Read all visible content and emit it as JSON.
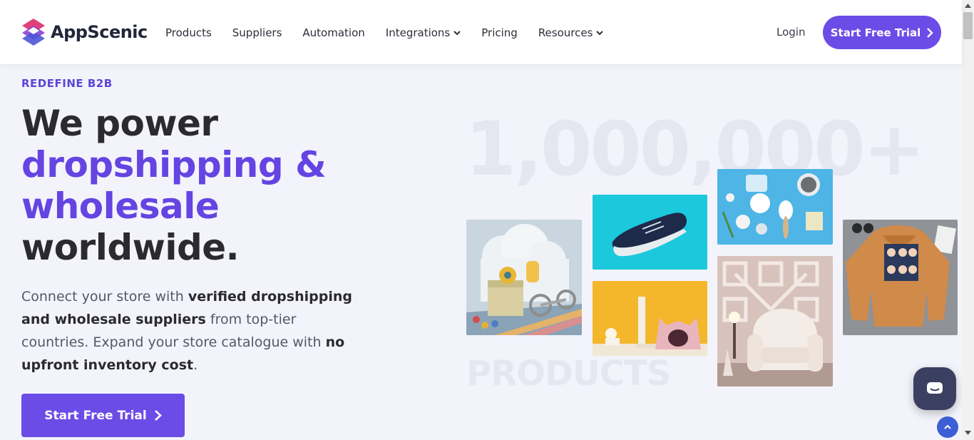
{
  "brand": {
    "name": "AppScenic",
    "accent_color": "#6c4ce7"
  },
  "nav": {
    "items": [
      {
        "label": "Products",
        "dropdown": false
      },
      {
        "label": "Suppliers",
        "dropdown": false
      },
      {
        "label": "Automation",
        "dropdown": false
      },
      {
        "label": "Integrations",
        "dropdown": true
      },
      {
        "label": "Pricing",
        "dropdown": false
      },
      {
        "label": "Resources",
        "dropdown": true
      }
    ],
    "login_label": "Login",
    "cta_label": "Start Free Trial"
  },
  "hero": {
    "eyebrow": "REDEFINE B2B",
    "headline_line1": "We power",
    "headline_line2": "dropshipping &",
    "headline_line3": "wholesale",
    "headline_line4": "worldwide.",
    "sub_part1": "Connect your store with ",
    "sub_bold1": "verified dropshipping and wholesale suppliers",
    "sub_part2": " from top-tier countries. Expand your store catalogue with ",
    "sub_bold2": "no upfront inventory cost",
    "sub_part3": ".",
    "cta_label": "Start Free Trial"
  },
  "showcase": {
    "big_number": "1,000,000+",
    "big_word": "PRODUCTS",
    "tiles": [
      "toys-image",
      "sneaker-image",
      "pet-bed-image",
      "cosmetics-image",
      "armchair-image",
      "hoodie-image"
    ]
  },
  "widgets": {
    "chat_icon": "chat-bubble-icon",
    "top_icon": "chevron-up-icon"
  }
}
